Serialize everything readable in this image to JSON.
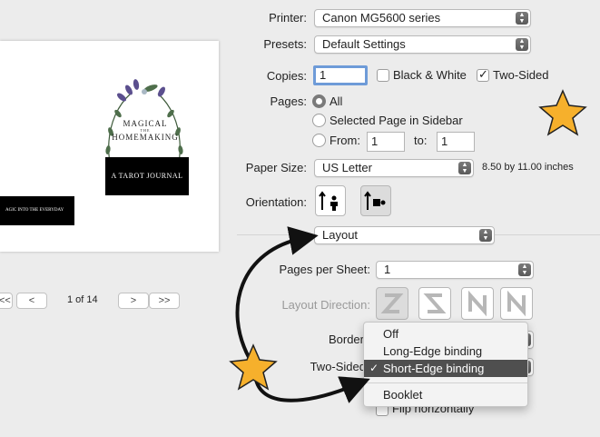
{
  "printer": {
    "label": "Printer:",
    "value": "Canon MG5600 series"
  },
  "presets": {
    "label": "Presets:",
    "value": "Default Settings"
  },
  "copies": {
    "label": "Copies:",
    "value": "1",
    "black_white_label": "Black & White",
    "black_white_checked": false,
    "two_sided_label": "Two-Sided",
    "two_sided_checked": true
  },
  "pages": {
    "label": "Pages:",
    "all_label": "All",
    "selected_label": "Selected Page in Sidebar",
    "from_label": "From:",
    "from_value": "1",
    "to_label": "to:",
    "to_value": "1",
    "selected_option": "All"
  },
  "paper_size": {
    "label": "Paper Size:",
    "value": "US Letter",
    "dimensions": "8.50 by 11.00 inches"
  },
  "orientation": {
    "label": "Orientation:",
    "selected": "landscape"
  },
  "section_popup": {
    "value": "Layout"
  },
  "layout": {
    "pages_per_sheet_label": "Pages per Sheet:",
    "pages_per_sheet_value": "1",
    "layout_direction_label": "Layout Direction:",
    "border_label": "Border",
    "two_sided_label": "Two-Sided",
    "flip_label": "Flip horizontally"
  },
  "two_sided_menu": {
    "items": [
      "Off",
      "Long-Edge binding",
      "Short-Edge binding",
      "Booklet"
    ],
    "selected": "Short-Edge binding",
    "check_mark": "✓"
  },
  "preview": {
    "title_line1": "MAGICAL",
    "title_small": "THE",
    "title_line2": "HOMEMAKING",
    "banner_text": "A TAROT JOURNAL",
    "side_banner_text": "AGIC INTO THE EVERYDAY",
    "page_indicator": "1 of 14",
    "nav": {
      "first": "|<<",
      "prev": "<",
      "next": ">",
      "last": ">>"
    }
  },
  "colors": {
    "star": "#f6b02c",
    "star_stroke": "#222222",
    "arrow": "#111111",
    "menu_highlight": "#4f4f4f"
  }
}
